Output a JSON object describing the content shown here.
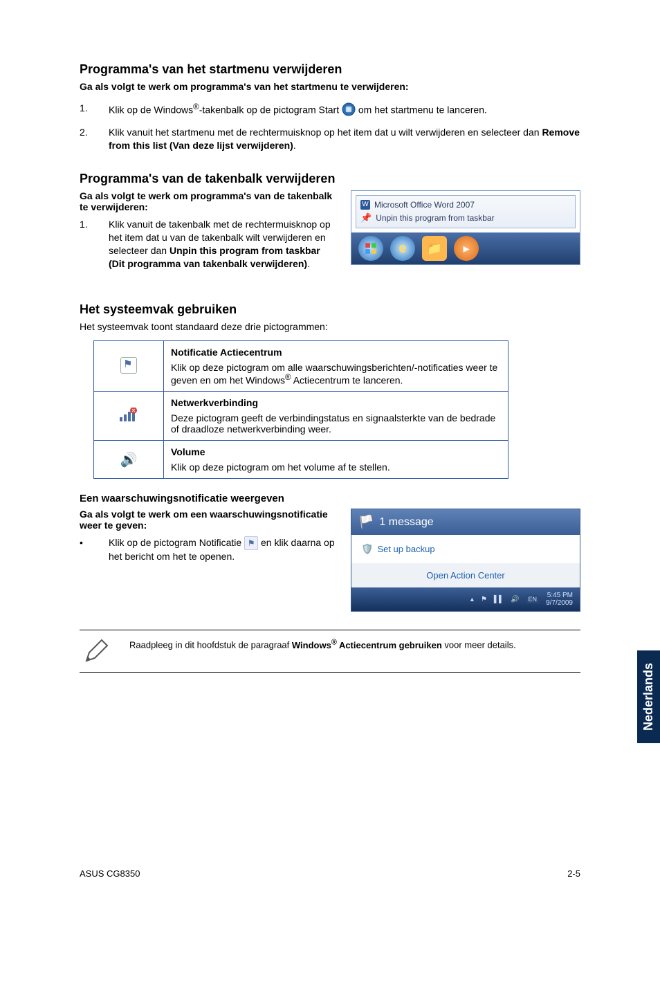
{
  "section1": {
    "title": "Programma's van het startmenu verwijderen",
    "procedure_intro": "Ga als volgt te werk om programma's van het startmenu te verwijderen:",
    "step1_a": "Klik op de Windows",
    "step1_reg": "®",
    "step1_b": "-takenbalk op de pictogram Start ",
    "step1_c": " om het startmenu te lanceren.",
    "step2_a": "Klik vanuit het startmenu met de rechtermuisknop op het item dat u wilt verwijderen en selecteer dan ",
    "step2_bold": "Remove from this list (Van deze lijst verwijderen)",
    "step2_b": "."
  },
  "section2": {
    "title": "Programma's van de takenbalk verwijderen",
    "procedure_intro": "Ga als volgt te werk om programma's van de takenbalk te verwijderen:",
    "step1_a": "Klik vanuit de takenbalk met de rechtermuisknop op het item dat u van de takenbalk wilt verwijderen en selecteer dan ",
    "step1_bold": "Unpin this program from taskbar (Dit programma van takenbalk verwijderen)",
    "step1_b": ".",
    "menu_item1": "Microsoft Office Word 2007",
    "menu_item2": "Unpin this program from taskbar"
  },
  "section3": {
    "title": "Het systeemvak gebruiken",
    "intro": "Het systeemvak toont standaard deze drie pictogrammen:",
    "row1_title": "Notificatie Actiecentrum",
    "row1_body_a": "Klik op deze pictogram om alle waarschuwingsberichten/-notificaties weer te geven en om het Windows",
    "row1_reg": "®",
    "row1_body_b": " Actiecentrum te lanceren.",
    "row2_title": "Netwerkverbinding",
    "row2_body": "Deze pictogram geeft de verbindingstatus en signaalsterkte van de bedrade of draadloze netwerkverbinding weer.",
    "row3_title": "Volume",
    "row3_body": "Klik op deze pictogram om het volume af te stellen."
  },
  "section4": {
    "title": "Een waarschuwingsnotificatie weergeven",
    "procedure_intro": "Ga als volgt te werk om een waarschuwingsnotificatie weer te geven:",
    "bullet_a": "Klik op de pictogram Notificatie ",
    "bullet_b": " en klik daarna op het bericht om het te openen.",
    "popup_header": "1 message",
    "popup_item": "Set up backup",
    "popup_link": "Open Action Center",
    "popup_time": "5:45 PM",
    "popup_date": "9/7/2009"
  },
  "note": {
    "a": "Raadpleeg in dit hoofdstuk de paragraaf ",
    "bold": "Windows",
    "reg": "®",
    "bold2": " Actiecentrum gebruiken",
    "b": " voor meer details."
  },
  "sidetab": "Nederlands",
  "footer_left": "ASUS CG8350",
  "footer_right": "2-5"
}
